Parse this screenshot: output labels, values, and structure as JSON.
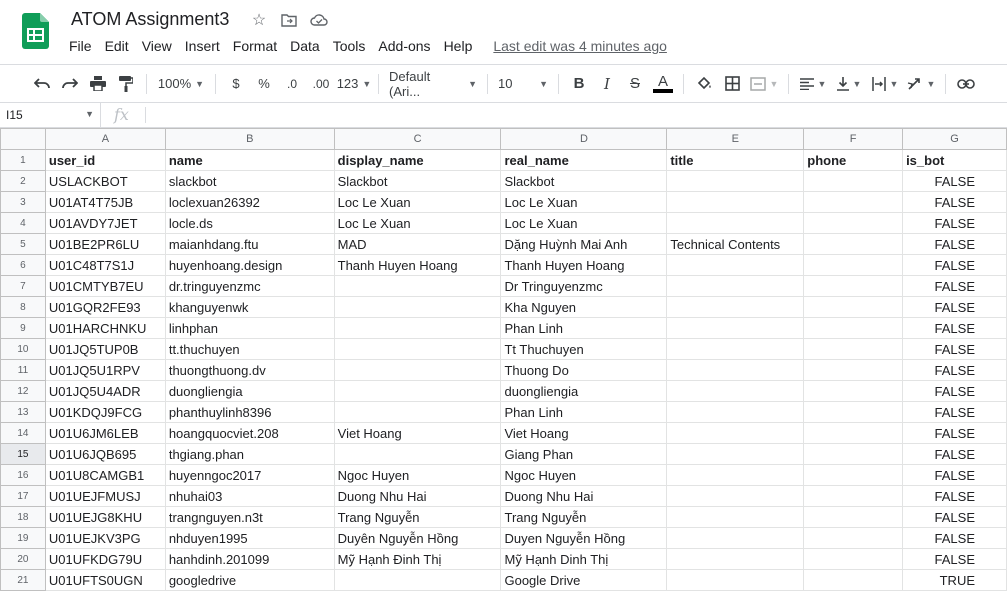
{
  "title": "ATOM Assignment3",
  "menu": [
    "File",
    "Edit",
    "View",
    "Insert",
    "Format",
    "Data",
    "Tools",
    "Add-ons",
    "Help"
  ],
  "last_edit": "Last edit was 4 minutes ago",
  "toolbar": {
    "zoom": "100%",
    "currency": "$",
    "percent": "%",
    "dec_less": ".0",
    "dec_more": ".00",
    "number_format": "123",
    "font": "Default (Ari...",
    "font_size": "10",
    "bold": "B",
    "italic": "I",
    "strike": "S",
    "text_color": "A"
  },
  "formula": {
    "cell_ref": "I15",
    "fx": "fx"
  },
  "columns": [
    "A",
    "B",
    "C",
    "D",
    "E",
    "F",
    "G"
  ],
  "rows": [
    [
      "user_id",
      "name",
      "display_name",
      "real_name",
      "title",
      "phone",
      "is_bot"
    ],
    [
      "USLACKBOT",
      "slackbot",
      "Slackbot",
      "Slackbot",
      "",
      "",
      "FALSE"
    ],
    [
      "U01AT4T75JB",
      "loclexuan26392",
      "Loc Le Xuan",
      "Loc Le Xuan",
      "",
      "",
      "FALSE"
    ],
    [
      "U01AVDY7JET",
      "locle.ds",
      "Loc Le Xuan",
      "Loc Le Xuan",
      "",
      "",
      "FALSE"
    ],
    [
      "U01BE2PR6LU",
      "maianhdang.ftu",
      "MAD",
      "Dặng Huỳnh Mai Anh",
      "Technical Contents",
      "",
      "FALSE"
    ],
    [
      "U01C48T7S1J",
      "huyenhoang.design",
      "Thanh Huyen Hoang",
      "Thanh Huyen Hoang",
      "",
      "",
      "FALSE"
    ],
    [
      "U01CMTYB7EU",
      "dr.tringuyenzmc",
      "",
      "Dr Tringuyenzmc",
      "",
      "",
      "FALSE"
    ],
    [
      "U01GQR2FE93",
      "khanguyenwk",
      "",
      "Kha Nguyen",
      "",
      "",
      "FALSE"
    ],
    [
      "U01HARCHNKU",
      "linhphan",
      "",
      "Phan Linh",
      "",
      "",
      "FALSE"
    ],
    [
      "U01JQ5TUP0B",
      "tt.thuchuyen",
      "",
      "Tt Thuchuyen",
      "",
      "",
      "FALSE"
    ],
    [
      "U01JQ5U1RPV",
      "thuongthuong.dv",
      "",
      "Thuong Do",
      "",
      "",
      "FALSE"
    ],
    [
      "U01JQ5U4ADR",
      "duongliengia",
      "",
      "duongliengia",
      "",
      "",
      "FALSE"
    ],
    [
      "U01KDQJ9FCG",
      "phanthuylinh8396",
      "",
      "Phan Linh",
      "",
      "",
      "FALSE"
    ],
    [
      "U01U6JM6LEB",
      "hoangquocviet.208",
      "Viet Hoang",
      "Viet Hoang",
      "",
      "",
      "FALSE"
    ],
    [
      "U01U6JQB695",
      "thgiang.phan",
      "",
      "Giang Phan",
      "",
      "",
      "FALSE"
    ],
    [
      "U01U8CAMGB1",
      "huyenngoc2017",
      "Ngoc Huyen",
      "Ngoc Huyen",
      "",
      "",
      "FALSE"
    ],
    [
      "U01UEJFMUSJ",
      "nhuhai03",
      "Duong Nhu Hai",
      "Duong Nhu Hai",
      "",
      "",
      "FALSE"
    ],
    [
      "U01UEJG8KHU",
      "trangnguyen.n3t",
      "Trang Nguyễn",
      "Trang Nguyễn",
      "",
      "",
      "FALSE"
    ],
    [
      "U01UEJKV3PG",
      "nhduyen1995",
      "Duyên Nguyễn Hồng",
      "Duyen Nguyễn Hồng",
      "",
      "",
      "FALSE"
    ],
    [
      "U01UFKDG79U",
      "hanhdinh.201099",
      "Mỹ Hạnh Đinh Thị",
      "Mỹ Hạnh Dinh Thị",
      "",
      "",
      "FALSE"
    ],
    [
      "U01UFTS0UGN",
      "googledrive",
      "",
      "Google Drive",
      "",
      "",
      "TRUE"
    ]
  ],
  "selected_row": 15,
  "colors": {
    "sheets_green": "#0f9d58",
    "header_bg": "#f8f9fa",
    "gridline": "#e2e3e3"
  }
}
